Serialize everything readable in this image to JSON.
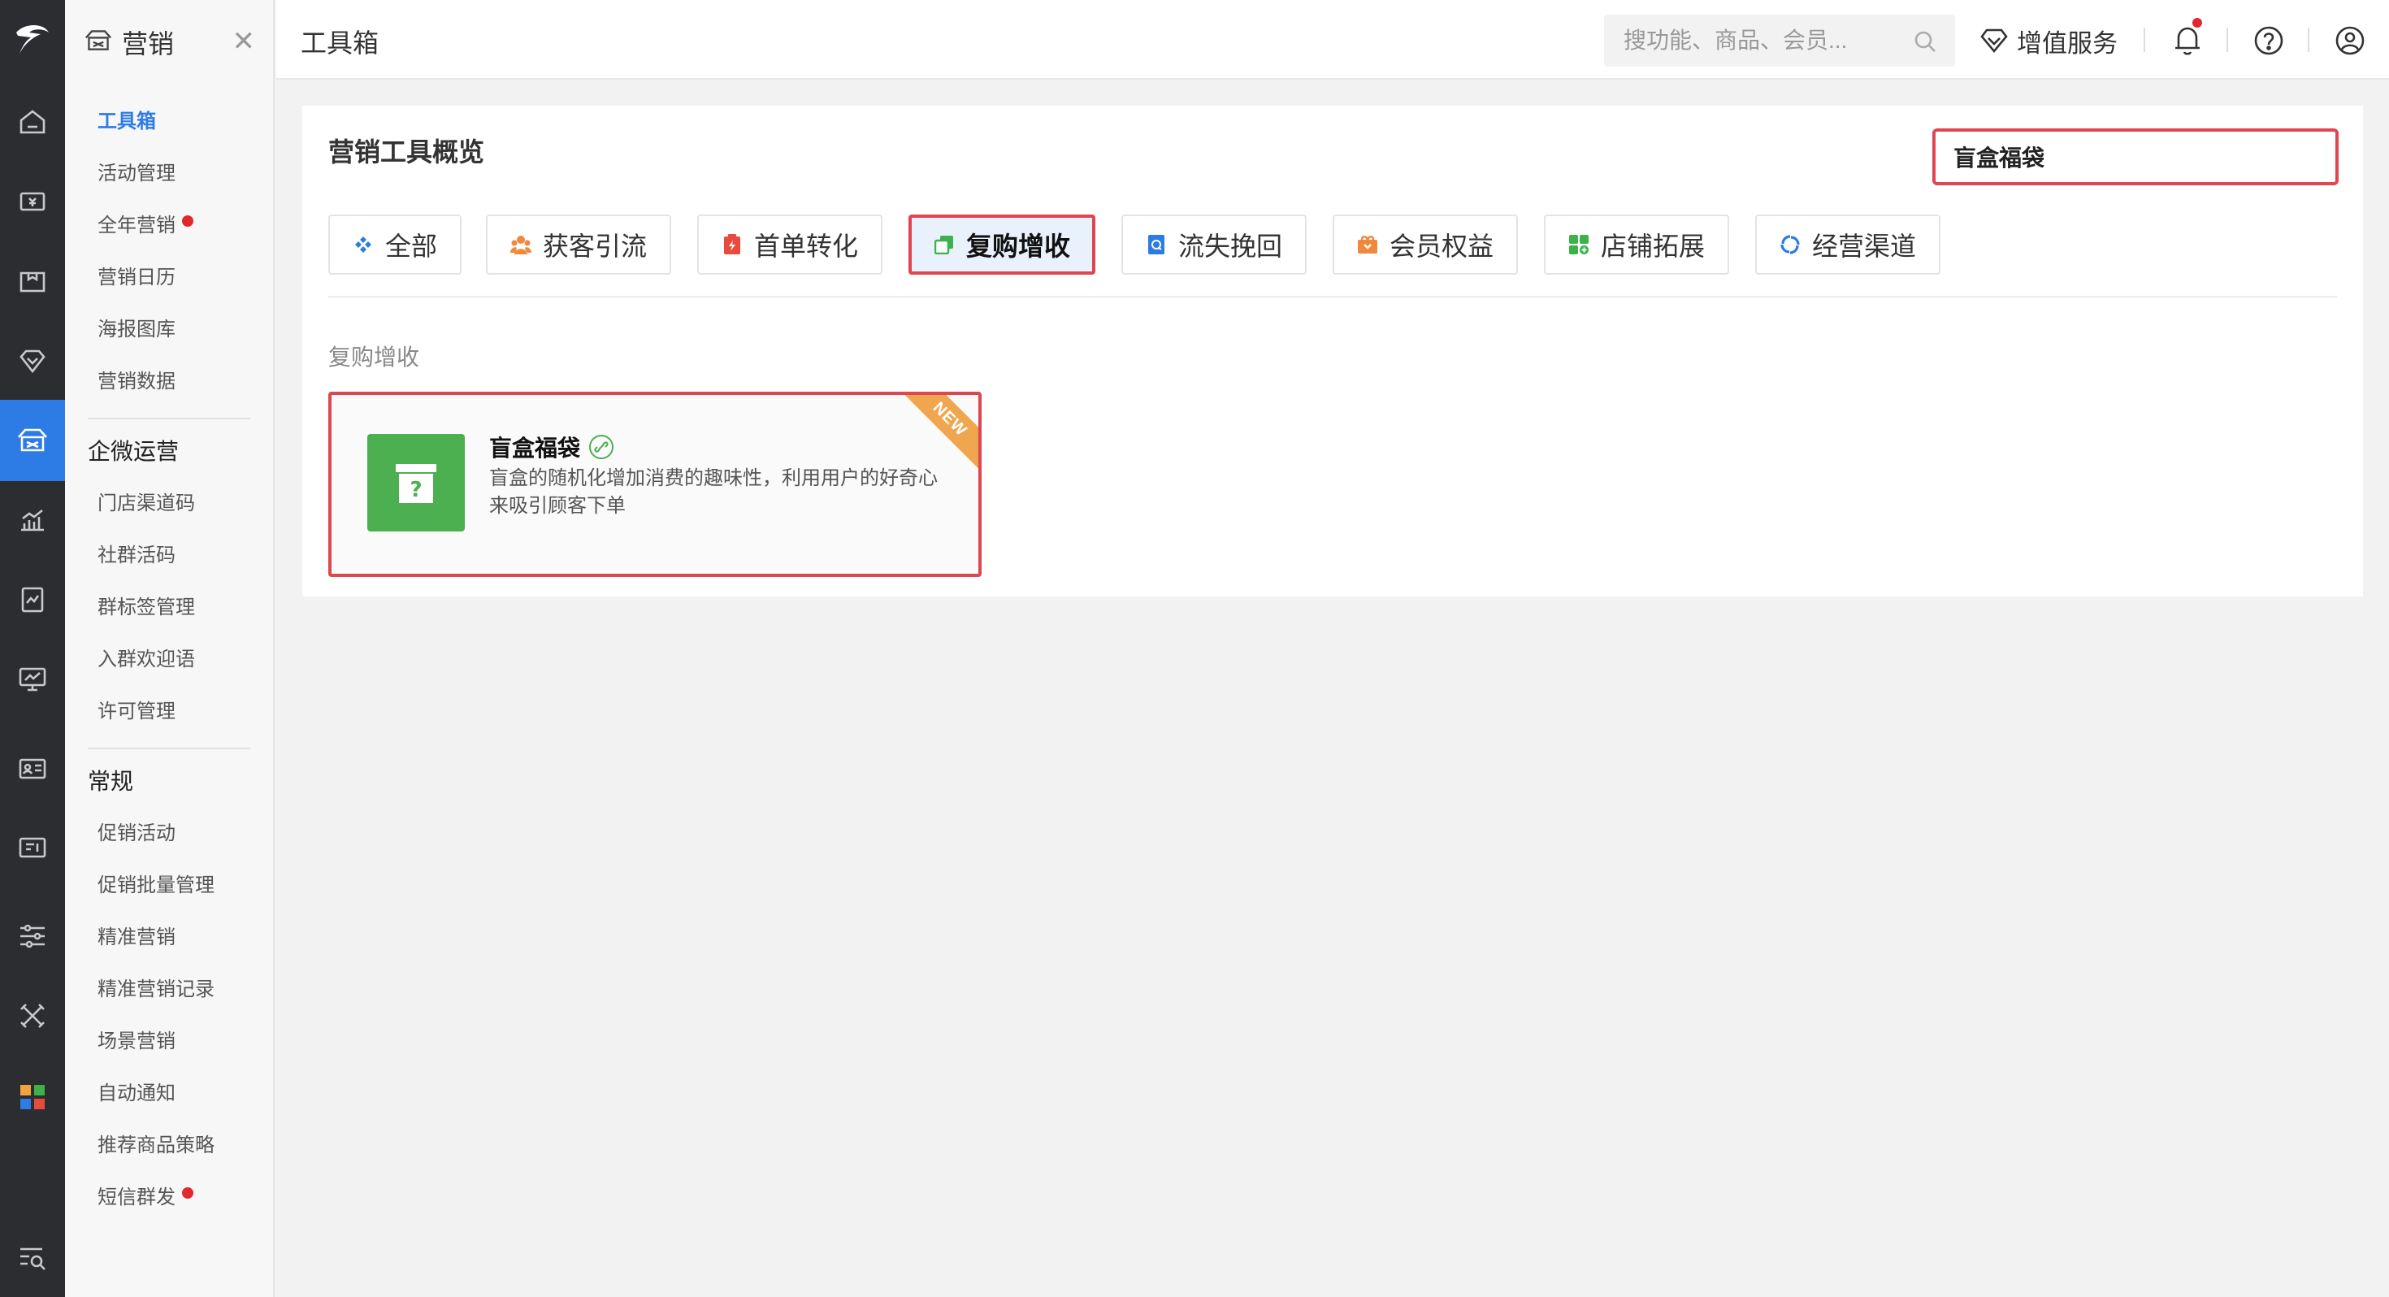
{
  "header": {
    "page_title": "工具箱",
    "search_placeholder": "搜功能、商品、会员...",
    "value_added_label": "增值服务"
  },
  "sidebar": {
    "title": "营销",
    "top_items": [
      {
        "label": "工具箱",
        "active": true
      },
      {
        "label": "活动管理"
      },
      {
        "label": "全年营销",
        "dot": true
      },
      {
        "label": "营销日历"
      },
      {
        "label": "海报图库"
      },
      {
        "label": "营销数据"
      }
    ],
    "groups": [
      {
        "title": "企微运营",
        "items": [
          {
            "label": "门店渠道码"
          },
          {
            "label": "社群活码"
          },
          {
            "label": "群标签管理"
          },
          {
            "label": "入群欢迎语"
          },
          {
            "label": "许可管理"
          }
        ]
      },
      {
        "title": "常规",
        "items": [
          {
            "label": "促销活动"
          },
          {
            "label": "促销批量管理"
          },
          {
            "label": "精准营销"
          },
          {
            "label": "精准营销记录"
          },
          {
            "label": "场景营销"
          },
          {
            "label": "自动通知"
          },
          {
            "label": "推荐商品策略"
          },
          {
            "label": "短信群发",
            "dot": true
          }
        ]
      }
    ]
  },
  "rail": {
    "icons": [
      "logo-icon",
      "home-icon",
      "cash-register-icon",
      "product-icon",
      "member-icon",
      "marketing-icon",
      "chart-icon",
      "report-icon",
      "monitor-icon",
      "id-card-icon",
      "device-icon",
      "settings-sliders-icon",
      "tools-icon",
      "apps-icon",
      "search-menu-icon"
    ]
  },
  "main": {
    "panel_title": "营销工具概览",
    "search_value": "盲盒福袋",
    "tabs": [
      {
        "label": "全部",
        "icon": "diamond-grid-icon",
        "color": "#2d7be5"
      },
      {
        "label": "获客引流",
        "icon": "people-icon",
        "color": "#f0883e"
      },
      {
        "label": "首单转化",
        "icon": "clipboard-bolt-icon",
        "color": "#e84a3e"
      },
      {
        "label": "复购增收",
        "icon": "copy-icon",
        "color": "#3bb24a",
        "active": true
      },
      {
        "label": "流失挽回",
        "icon": "refresh-doc-icon",
        "color": "#2d7be5"
      },
      {
        "label": "会员权益",
        "icon": "gift-box-icon",
        "color": "#f0883e"
      },
      {
        "label": "店铺拓展",
        "icon": "store-plus-icon",
        "color": "#3bb24a"
      },
      {
        "label": "经营渠道",
        "icon": "cycle-icon",
        "color": "#2d7be5"
      }
    ],
    "section_title": "复购增收",
    "cards": [
      {
        "name": "盲盒福袋",
        "description": "盲盒的随机化增加消费的趣味性，利用用户的好奇心来吸引顾客下单",
        "badge": "NEW",
        "icon": "mystery-box-icon",
        "icon_color": "#4caf50"
      }
    ]
  },
  "colors": {
    "accent": "#2d7be5",
    "highlight_border": "#e04552",
    "rail_bg": "#2b2d31"
  }
}
